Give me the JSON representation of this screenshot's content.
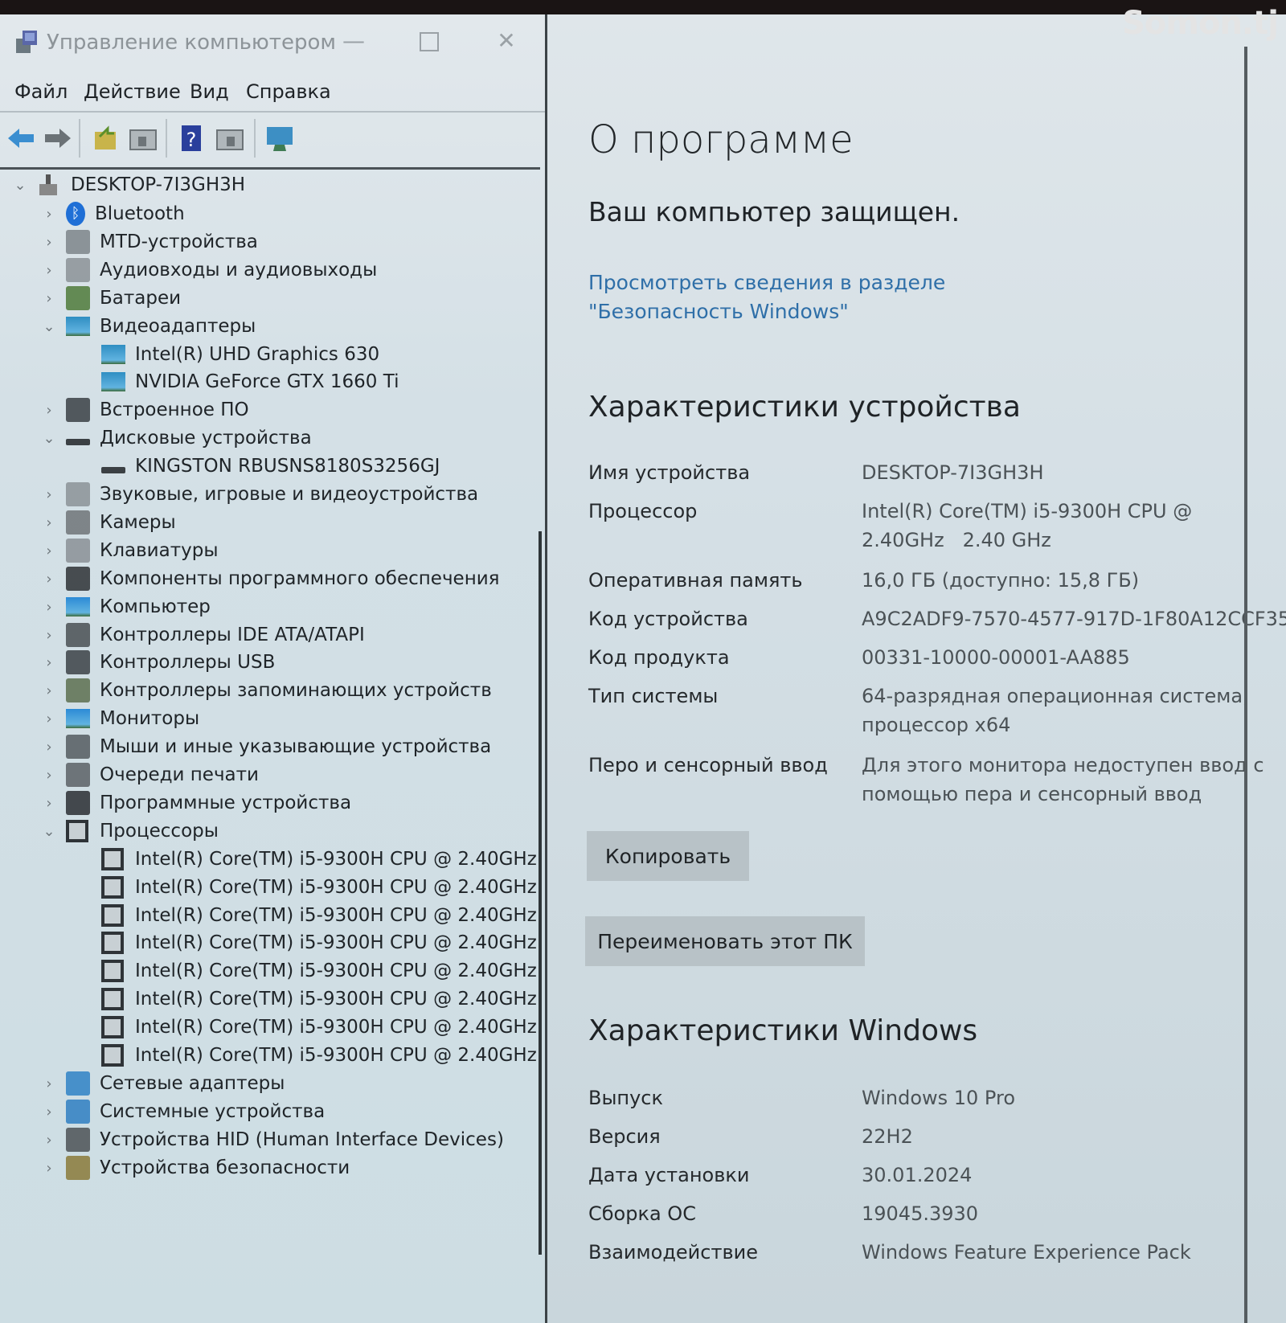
{
  "watermark": "Somon.tj",
  "window": {
    "title": "Управление компьютером",
    "controls": {
      "minimize": "—",
      "close": "✕"
    }
  },
  "menu": [
    "Файл",
    "Действие",
    "Вид",
    "Справка"
  ],
  "toolbar": [
    "back-icon",
    "forward-icon",
    "up-folder-icon",
    "show-hide-tree-icon",
    "help-icon",
    "show-action-pane-icon",
    "monitor-icon"
  ],
  "tree": {
    "root": "DESKTOP-7I3GH3H",
    "items": [
      {
        "label": "Bluetooth",
        "icon": "bluetooth-icon",
        "expanded": false,
        "level": 1
      },
      {
        "label": "MTD-устройства",
        "icon": "mtd-device-icon",
        "expanded": false,
        "level": 1
      },
      {
        "label": "Аудиовходы и аудиовыходы",
        "icon": "speaker-icon",
        "expanded": false,
        "level": 1
      },
      {
        "label": "Батареи",
        "icon": "battery-icon",
        "expanded": false,
        "level": 1
      },
      {
        "label": "Видеоадаптеры",
        "icon": "display-adapter-icon",
        "expanded": true,
        "level": 1
      },
      {
        "label": "Intel(R) UHD Graphics 630",
        "icon": "display-adapter-icon",
        "level": 2
      },
      {
        "label": "NVIDIA GeForce GTX 1660 Ti",
        "icon": "display-adapter-icon",
        "level": 2
      },
      {
        "label": "Встроенное ПО",
        "icon": "firmware-icon",
        "expanded": false,
        "level": 1
      },
      {
        "label": "Дисковые устройства",
        "icon": "disk-drive-icon",
        "expanded": true,
        "level": 1
      },
      {
        "label": "KINGSTON RBUSNS8180S3256GJ",
        "icon": "disk-drive-icon",
        "level": 2
      },
      {
        "label": "Звуковые, игровые и видеоустройства",
        "icon": "speaker-icon",
        "expanded": false,
        "level": 1
      },
      {
        "label": "Камеры",
        "icon": "camera-icon",
        "expanded": false,
        "level": 1
      },
      {
        "label": "Клавиатуры",
        "icon": "keyboard-icon",
        "expanded": false,
        "level": 1
      },
      {
        "label": "Компоненты программного обеспечения",
        "icon": "software-component-icon",
        "expanded": false,
        "level": 1
      },
      {
        "label": "Компьютер",
        "icon": "computer-icon",
        "expanded": false,
        "level": 1
      },
      {
        "label": "Контроллеры IDE ATA/ATAPI",
        "icon": "ide-controller-icon",
        "expanded": false,
        "level": 1
      },
      {
        "label": "Контроллеры USB",
        "icon": "usb-icon",
        "expanded": false,
        "level": 1
      },
      {
        "label": "Контроллеры запоминающих устройств",
        "icon": "storage-controller-icon",
        "expanded": false,
        "level": 1
      },
      {
        "label": "Мониторы",
        "icon": "monitor-icon",
        "expanded": false,
        "level": 1
      },
      {
        "label": "Мыши и иные указывающие устройства",
        "icon": "mouse-icon",
        "expanded": false,
        "level": 1
      },
      {
        "label": "Очереди печати",
        "icon": "printer-icon",
        "expanded": false,
        "level": 1
      },
      {
        "label": "Программные устройства",
        "icon": "software-device-icon",
        "expanded": false,
        "level": 1
      },
      {
        "label": "Процессоры",
        "icon": "processor-icon",
        "expanded": true,
        "level": 1
      },
      {
        "label": "Intel(R) Core(TM) i5-9300H CPU @ 2.40GHz",
        "icon": "processor-icon",
        "level": 2
      },
      {
        "label": "Intel(R) Core(TM) i5-9300H CPU @ 2.40GHz",
        "icon": "processor-icon",
        "level": 2
      },
      {
        "label": "Intel(R) Core(TM) i5-9300H CPU @ 2.40GHz",
        "icon": "processor-icon",
        "level": 2
      },
      {
        "label": "Intel(R) Core(TM) i5-9300H CPU @ 2.40GHz",
        "icon": "processor-icon",
        "level": 2
      },
      {
        "label": "Intel(R) Core(TM) i5-9300H CPU @ 2.40GHz",
        "icon": "processor-icon",
        "level": 2
      },
      {
        "label": "Intel(R) Core(TM) i5-9300H CPU @ 2.40GHz",
        "icon": "processor-icon",
        "level": 2
      },
      {
        "label": "Intel(R) Core(TM) i5-9300H CPU @ 2.40GHz",
        "icon": "processor-icon",
        "level": 2
      },
      {
        "label": "Intel(R) Core(TM) i5-9300H CPU @ 2.40GHz",
        "icon": "processor-icon",
        "level": 2
      },
      {
        "label": "Сетевые адаптеры",
        "icon": "network-adapter-icon",
        "expanded": false,
        "level": 1
      },
      {
        "label": "Системные устройства",
        "icon": "system-device-icon",
        "expanded": false,
        "level": 1
      },
      {
        "label": "Устройства HID (Human Interface Devices)",
        "icon": "hid-icon",
        "expanded": false,
        "level": 1
      },
      {
        "label": "Устройства безопасности",
        "icon": "security-device-icon",
        "expanded": false,
        "level": 1
      }
    ]
  },
  "about": {
    "title": "О программе",
    "protected": "Ваш компьютер защищен.",
    "security_link": "Просмотреть сведения в разделе \"Безопасность Windows\"",
    "device_specs": {
      "heading": "Характеристики устройства",
      "rows": [
        {
          "label": "Имя устройства",
          "value": "DESKTOP-7I3GH3H"
        },
        {
          "label": "Процессор",
          "value": "Intel(R) Core(TM) i5-9300H CPU @\n2.40GHz   2.40 GHz"
        },
        {
          "label": "Оперативная память",
          "value": "16,0 ГБ (доступно: 15,8 ГБ)"
        },
        {
          "label": "Код устройства",
          "value": "A9C2ADF9-7570-4577-917D-1F80A12CCF35"
        },
        {
          "label": "Код продукта",
          "value": "00331-10000-00001-AA885"
        },
        {
          "label": "Тип системы",
          "value": "64-разрядная операционная система,\nпроцессор x64"
        },
        {
          "label": "Перо и сенсорный ввод",
          "value": "Для этого монитора недоступен ввод с\nпомощью пера и сенсорный ввод"
        }
      ],
      "copy_button": "Копировать",
      "rename_button": "Переименовать этот ПК"
    },
    "windows_specs": {
      "heading": "Характеристики Windows",
      "rows": [
        {
          "label": "Выпуск",
          "value": "Windows 10 Pro"
        },
        {
          "label": "Версия",
          "value": "22H2"
        },
        {
          "label": "Дата установки",
          "value": "30.01.2024"
        },
        {
          "label": "Сборка ОС",
          "value": "19045.3930"
        },
        {
          "label": "Взаимодействие",
          "value": "Windows Feature Experience Pack"
        }
      ]
    }
  }
}
